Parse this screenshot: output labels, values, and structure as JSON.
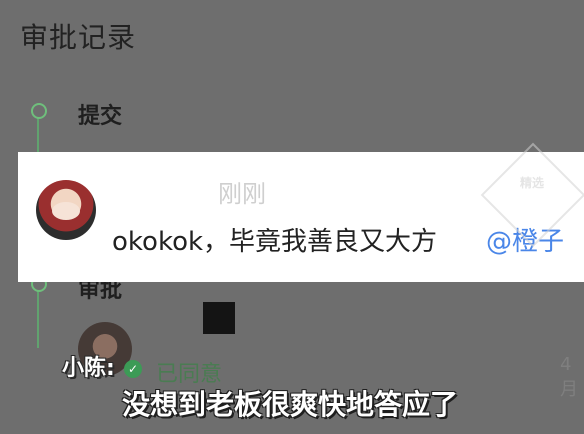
{
  "page": {
    "title": "审批记录",
    "steps": [
      {
        "label": "提交"
      },
      {
        "label": "审批"
      }
    ]
  },
  "toast": {
    "time": "刚刚",
    "message": "okokok，毕竟我善良又大方",
    "mention": "@橙子"
  },
  "approval": {
    "status": "已同意",
    "date": "4月"
  },
  "watermark": {
    "text": "精选"
  },
  "subtitle": {
    "speaker": "小陈:",
    "text": "没想到老板很爽快地答应了"
  },
  "colors": {
    "background": "#6e6e6e",
    "accent_green": "#6fbf7c",
    "mention_blue": "#4a86e8"
  }
}
